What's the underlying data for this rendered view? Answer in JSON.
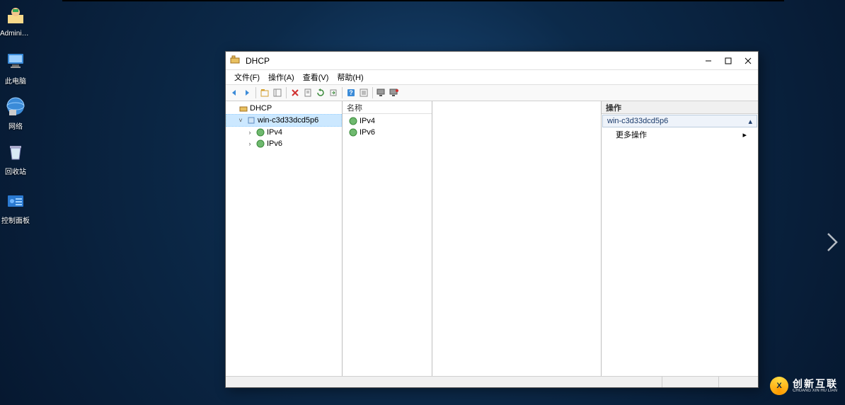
{
  "desktop": {
    "icons": [
      {
        "name": "administrator-icon",
        "label": "Administr..."
      },
      {
        "name": "this-pc-icon",
        "label": "此电脑"
      },
      {
        "name": "network-icon",
        "label": "网络"
      },
      {
        "name": "recycle-bin-icon",
        "label": "回收站"
      },
      {
        "name": "control-panel-icon",
        "label": "控制面板"
      }
    ]
  },
  "window": {
    "title": "DHCP",
    "menu": {
      "file": "文件(F)",
      "action": "操作(A)",
      "view": "查看(V)",
      "help": "帮助(H)"
    },
    "tree": {
      "root": "DHCP",
      "server": "win-c3d33dcd5p6",
      "ipv4": "IPv4",
      "ipv6": "IPv6"
    },
    "list": {
      "header": "名称",
      "rows": [
        "IPv4",
        "IPv6"
      ]
    },
    "actions": {
      "header": "操作",
      "sub": "win-c3d33dcd5p6",
      "more": "更多操作"
    }
  },
  "watermark": {
    "cn": "创新互联",
    "en": "CHUANG XIN HU LIAN"
  }
}
